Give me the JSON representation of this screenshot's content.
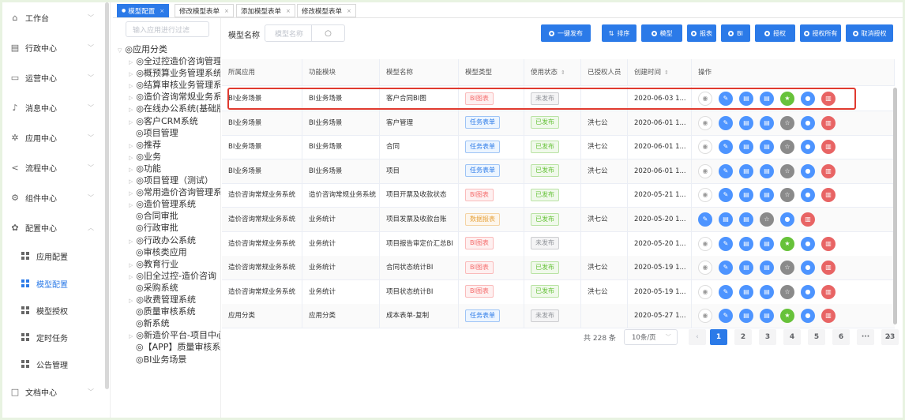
{
  "sidebar": {
    "items": [
      {
        "label": "工作台",
        "icon": "home-icon",
        "glyph": "⌂"
      },
      {
        "label": "行政中心",
        "icon": "building-icon",
        "glyph": "▤"
      },
      {
        "label": "运营中心",
        "icon": "monitor-icon",
        "glyph": "▭"
      },
      {
        "label": "消息中心",
        "icon": "bell-icon",
        "glyph": "♪"
      },
      {
        "label": "应用中心",
        "icon": "settings-icon",
        "glyph": "✲"
      },
      {
        "label": "流程中心",
        "icon": "share-icon",
        "glyph": "<"
      },
      {
        "label": "组件中心",
        "icon": "gear-icon",
        "glyph": "⚙"
      },
      {
        "label": "配置中心",
        "icon": "config-icon",
        "glyph": "✿"
      }
    ],
    "sub_items": [
      {
        "label": "应用配置"
      },
      {
        "label": "模型配置"
      },
      {
        "label": "模型授权"
      },
      {
        "label": "定时任务"
      },
      {
        "label": "公告管理"
      }
    ],
    "doc": {
      "label": "文档中心",
      "icon": "folder-icon",
      "glyph": "□"
    }
  },
  "tabs": [
    {
      "label": "模型配置"
    },
    {
      "label": "修改模型表单"
    },
    {
      "label": "添加模型表单"
    },
    {
      "label": "修改模型表单"
    }
  ],
  "tree": {
    "search_placeholder": "输入应用进行过滤",
    "root": "◎应用分类",
    "nodes": [
      {
        "label": "◎全过控造价咨询管理",
        "expandable": true
      },
      {
        "label": "◎概预算业务管理系统",
        "expandable": true
      },
      {
        "label": "◎结算审核业务管理系",
        "expandable": true
      },
      {
        "label": "◎造价咨询常规业务系",
        "expandable": true
      },
      {
        "label": "◎在线办公系统(基础版",
        "expandable": true
      },
      {
        "label": "◎客户CRM系统",
        "expandable": true
      },
      {
        "label": "◎项目管理",
        "expandable": false
      },
      {
        "label": "◎推荐",
        "expandable": true
      },
      {
        "label": "◎业务",
        "expandable": true
      },
      {
        "label": "◎功能",
        "expandable": true
      },
      {
        "label": "◎项目管理（测试）",
        "expandable": true
      },
      {
        "label": "◎常用造价咨询管理系",
        "expandable": true
      },
      {
        "label": "◎造价管理系统",
        "expandable": true
      },
      {
        "label": "◎合同审批",
        "expandable": false
      },
      {
        "label": "◎行政审批",
        "expandable": false
      },
      {
        "label": "◎行政办公系统",
        "expandable": true
      },
      {
        "label": "◎审核类应用",
        "expandable": false
      },
      {
        "label": "◎教育行业",
        "expandable": true
      },
      {
        "label": "◎旧全过控-造价咨询",
        "expandable": true
      },
      {
        "label": "◎采购系统",
        "expandable": false
      },
      {
        "label": "◎收费管理系统",
        "expandable": true
      },
      {
        "label": "◎质量审核系统",
        "expandable": false
      },
      {
        "label": "◎新系统",
        "expandable": false
      },
      {
        "label": "◎新造价平台-项目中心",
        "expandable": true
      },
      {
        "label": "◎【APP】质量审核系",
        "expandable": false
      },
      {
        "label": "◎BI业务场景",
        "expandable": false
      }
    ]
  },
  "filter": {
    "label": "模型名称",
    "placeholder": "模型名称"
  },
  "toolbar": [
    {
      "label": "一键发布"
    },
    {
      "label": "排序"
    },
    {
      "label": "模型"
    },
    {
      "label": "报表"
    },
    {
      "label": "BI"
    },
    {
      "label": "授权"
    },
    {
      "label": "授权所有"
    },
    {
      "label": "取消授权"
    }
  ],
  "table": {
    "headers": [
      "所属应用",
      "功能模块",
      "模型名称",
      "模型类型",
      "使用状态",
      "已授权人员",
      "创建时间",
      "操作"
    ],
    "rows": [
      {
        "app": "BI业务场景",
        "module": "BI业务场景",
        "name": "客户合同BI图",
        "type": "BI图表",
        "status": "未发布",
        "auth": "",
        "created": "2020-06-03 1...",
        "ops": [
          "eye",
          "edit",
          "doc",
          "doc",
          "star-green",
          "user",
          "delete"
        ]
      },
      {
        "app": "BI业务场景",
        "module": "BI业务场景",
        "name": "客户管理",
        "type": "任务表单",
        "status": "已发布",
        "auth": "洪七公",
        "created": "2020-06-01 1...",
        "ops": [
          "eye",
          "edit",
          "doc",
          "doc",
          "star-gray",
          "user",
          "delete"
        ]
      },
      {
        "app": "BI业务场景",
        "module": "BI业务场景",
        "name": "合同",
        "type": "任务表单",
        "status": "已发布",
        "auth": "洪七公",
        "created": "2020-06-01 1...",
        "ops": [
          "eye",
          "edit",
          "doc",
          "doc",
          "star-gray",
          "user",
          "delete"
        ]
      },
      {
        "app": "BI业务场景",
        "module": "BI业务场景",
        "name": "项目",
        "type": "任务表单",
        "status": "已发布",
        "auth": "洪七公",
        "created": "2020-06-01 1...",
        "ops": [
          "eye",
          "edit",
          "doc",
          "doc",
          "star-gray",
          "user",
          "delete"
        ]
      },
      {
        "app": "造价咨询常规业务系统",
        "module": "造价咨询常规业务系统",
        "name": "项目开票及收款状态",
        "type": "BI图表",
        "status": "已发布",
        "auth": "",
        "created": "2020-05-21 1...",
        "ops": [
          "eye",
          "edit",
          "doc",
          "doc",
          "star-gray",
          "user",
          "delete"
        ]
      },
      {
        "app": "造价咨询常规业务系统",
        "module": "业务统计",
        "name": "项目发票及收款台账",
        "type": "数据报表",
        "status": "已发布",
        "auth": "洪七公",
        "created": "2020-05-20 1...",
        "ops": [
          "edit",
          "doc",
          "doc",
          "star-gray",
          "user",
          "delete"
        ]
      },
      {
        "app": "造价咨询常规业务系统",
        "module": "业务统计",
        "name": "项目报告审定价汇总BI",
        "type": "BI图表",
        "status": "未发布",
        "auth": "",
        "created": "2020-05-20 1...",
        "ops": [
          "eye",
          "edit",
          "doc",
          "doc",
          "star-green",
          "user",
          "delete"
        ]
      },
      {
        "app": "造价咨询常规业务系统",
        "module": "业务统计",
        "name": "合同状态统计BI",
        "type": "BI图表",
        "status": "已发布",
        "auth": "洪七公",
        "created": "2020-05-19 1...",
        "ops": [
          "eye",
          "edit",
          "doc",
          "doc",
          "star-gray",
          "user",
          "delete"
        ]
      },
      {
        "app": "造价咨询常规业务系统",
        "module": "业务统计",
        "name": "项目状态统计BI",
        "type": "BI图表",
        "status": "已发布",
        "auth": "洪七公",
        "created": "2020-05-19 1...",
        "ops": [
          "eye",
          "edit",
          "doc",
          "doc",
          "star-gray",
          "user",
          "delete"
        ]
      },
      {
        "app": "应用分类",
        "module": "应用分类",
        "name": "成本表单-复制",
        "type": "任务表单",
        "status": "未发布",
        "auth": "",
        "created": "2020-05-27 1...",
        "ops": [
          "eye",
          "edit",
          "doc",
          "doc",
          "star-green",
          "user",
          "delete"
        ]
      }
    ]
  },
  "pager": {
    "total": "共 228 条",
    "page_size": "10条/页",
    "pages": [
      "1",
      "2",
      "3",
      "4",
      "5",
      "6",
      "···",
      "23"
    ],
    "prev": "‹",
    "next": "›"
  },
  "colors": {
    "accent": "#2b7ae8",
    "danger": "#e86464",
    "success": "#67c23a",
    "gray": "#8a8a8a",
    "highlight": "#e03a2f"
  }
}
